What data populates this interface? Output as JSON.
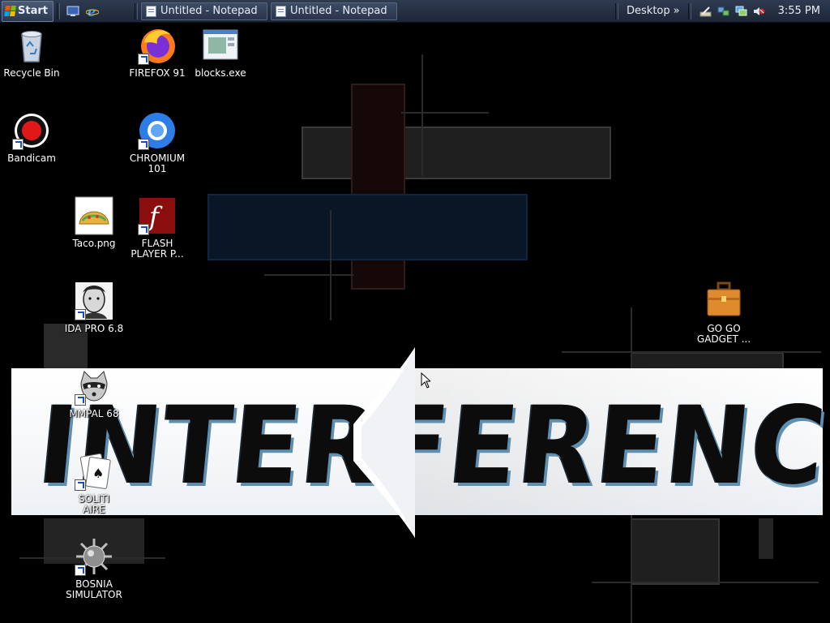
{
  "taskbar": {
    "start_label": "Start",
    "tasks": [
      {
        "label": "Untitled - Notepad"
      },
      {
        "label": "Untitled - Notepad"
      }
    ],
    "desktop_label": "Desktop",
    "desktop_chevron": "»",
    "clock": "3:55 PM"
  },
  "wallpaper": {
    "banner_text": "INTERFERENCE"
  },
  "icons": [
    {
      "label": "Recycle Bin",
      "icon": "recycle-bin-icon"
    },
    {
      "label": "FIREFOX 91",
      "icon": "firefox-icon"
    },
    {
      "label": "blocks.exe",
      "icon": "blocks-exe-icon"
    },
    {
      "label": "Bandicam",
      "icon": "bandicam-icon"
    },
    {
      "label": "CHROMIUM\n101",
      "icon": "chromium-icon"
    },
    {
      "label": "Taco.png",
      "icon": "taco-image-icon"
    },
    {
      "label": "FLASH\nPLAYER P...",
      "icon": "flash-player-icon"
    },
    {
      "label": "IDA PRO 6.8",
      "icon": "ida-pro-icon"
    },
    {
      "label": "GO GO\nGADGET ...",
      "icon": "briefcase-icon"
    },
    {
      "label": "MMPAL 68",
      "icon": "raccoon-icon"
    },
    {
      "label": "SOLITI\nAIRE",
      "icon": "solitaire-cards-icon"
    },
    {
      "label": "BOSNIA\nSIMULATOR",
      "icon": "spiked-mine-icon"
    }
  ],
  "colors": {
    "taskbar": "#1c2636",
    "desktop_bg": "#000000",
    "banner": "#ffffff",
    "banner_accent": "#5f8fb0"
  }
}
